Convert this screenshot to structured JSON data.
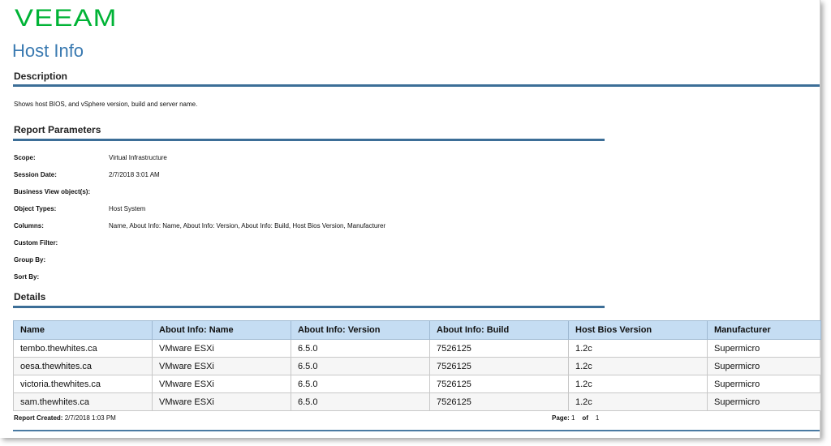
{
  "logo": {
    "text": "VEEAM",
    "color": "#00b336"
  },
  "report": {
    "title": "Host Info"
  },
  "description": {
    "heading": "Description",
    "text": "Shows host BIOS, and vSphere version, build and server name."
  },
  "parameters": {
    "heading": "Report Parameters",
    "rows": [
      {
        "label": "Scope:",
        "value": "Virtual Infrastructure"
      },
      {
        "label": "Session Date:",
        "value": "2/7/2018 3:01 AM"
      },
      {
        "label": "Business View object(s):",
        "value": ""
      },
      {
        "label": "Object Types:",
        "value": "Host System"
      },
      {
        "label": "Columns:",
        "value": "Name, About Info: Name, About Info: Version, About Info: Build, Host Bios Version, Manufacturer"
      },
      {
        "label": "Custom Filter:",
        "value": ""
      },
      {
        "label": "Group By:",
        "value": ""
      },
      {
        "label": "Sort By:",
        "value": ""
      }
    ]
  },
  "details": {
    "heading": "Details",
    "columns": [
      "Name",
      "About Info: Name",
      "About Info: Version",
      "About Info: Build",
      "Host Bios Version",
      "Manufacturer"
    ],
    "rows": [
      [
        "tembo.thewhites.ca",
        "VMware ESXi",
        "6.5.0",
        "7526125",
        "1.2c",
        "Supermicro"
      ],
      [
        "oesa.thewhites.ca",
        "VMware ESXi",
        "6.5.0",
        "7526125",
        "1.2c",
        "Supermicro"
      ],
      [
        "victoria.thewhites.ca",
        "VMware ESXi",
        "6.5.0",
        "7526125",
        "1.2c",
        "Supermicro"
      ],
      [
        "sam.thewhites.ca",
        "VMware ESXi",
        "6.5.0",
        "7526125",
        "1.2c",
        "Supermicro"
      ]
    ]
  },
  "footer": {
    "created_label": "Report Created:",
    "created_value": "2/7/2018 1:03 PM",
    "page_label": "Page:",
    "page_current": "1",
    "page_of": "of",
    "page_total": "1"
  },
  "colors": {
    "title": "#3a7ab1",
    "rule": "#3c6e97",
    "table_header": "#c5ddf3"
  }
}
